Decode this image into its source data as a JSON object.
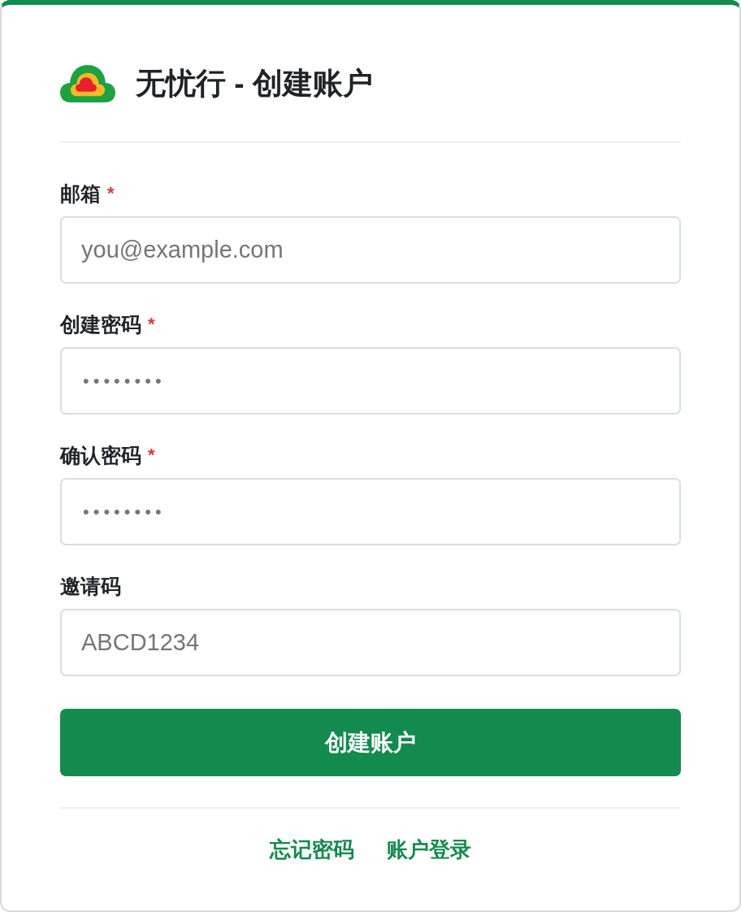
{
  "header": {
    "title": "无忧行 - 创建账户"
  },
  "fields": [
    {
      "label": "邮箱",
      "required_mark": "*",
      "kind": "email",
      "placeholder": "you@example.com"
    },
    {
      "label": "创建密码",
      "required_mark": "*",
      "kind": "password",
      "placeholder": "••••••••"
    },
    {
      "label": "确认密码",
      "required_mark": "*",
      "kind": "password",
      "placeholder": "••••••••"
    },
    {
      "label": "邀请码",
      "kind": "text",
      "placeholder": "ABCD1234"
    }
  ],
  "submit_button": {
    "label": "创建账户"
  },
  "links": [
    {
      "label": "忘记密码"
    },
    {
      "label": "账户登录"
    }
  ]
}
